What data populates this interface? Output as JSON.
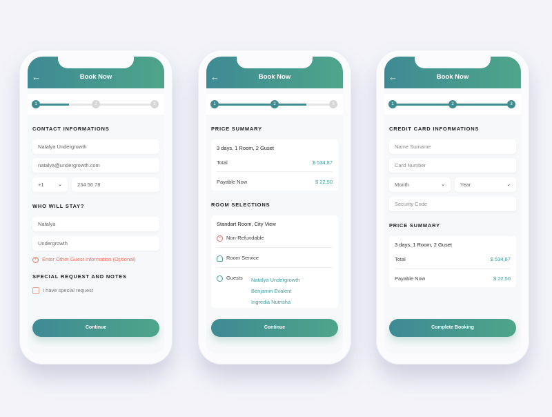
{
  "colors": {
    "accent": "#3f8b8f",
    "gradient_end": "#4ea58a",
    "link_red": "#e8735f"
  },
  "header": {
    "title": "Book Now",
    "back_icon": "arrow-left"
  },
  "steps": [
    "1",
    "2",
    "3"
  ],
  "screen1": {
    "contact_title": "CONTACT INFORMATIONS",
    "name": "Natalya Undergrowth",
    "email": "natalya@undergrowth.com",
    "country_code": "+1",
    "phone": "234 56 78",
    "who_title": "WHO WILL STAY?",
    "first_name": "Natalya",
    "last_name": "Undergrowth",
    "add_guest": "Enter Other Guest Information (Optional)",
    "notes_title": "SPECIAL REQUEST AND NOTES",
    "checkbox_label": "I have special request",
    "button": "Continue"
  },
  "screen2": {
    "price_title": "PRICE SUMMARY",
    "summary": "3 days, 1 Room, 2 Guset",
    "total_label": "Total",
    "total": "$ 534,87",
    "payable_label": "Payable Now",
    "payable": "$ 22,50",
    "room_title": "ROOM SELECTIONS",
    "room": "Standart Room, City View",
    "non_refundable": "Non-Refundable",
    "room_service": "Room Service",
    "guests_label": "Guests",
    "guests": [
      "Natalya Undergrowth",
      "Benjamin Evalent",
      "Ingredia Nutrisha"
    ],
    "button": "Continue"
  },
  "screen3": {
    "card_title": "CREDIT CARD INFORMATIONS",
    "name_placeholder": "Name Surname",
    "card_placeholder": "Card Number",
    "month": "Month",
    "year": "Year",
    "cvc_placeholder": "Security Code",
    "price_title": "PRICE SUMMARY",
    "summary": "3 days, 1 Room, 2 Guset",
    "total_label": "Total",
    "total": "$ 534,87",
    "payable_label": "Payable Now",
    "payable": "$ 22,50",
    "button": "Complete Booking"
  }
}
